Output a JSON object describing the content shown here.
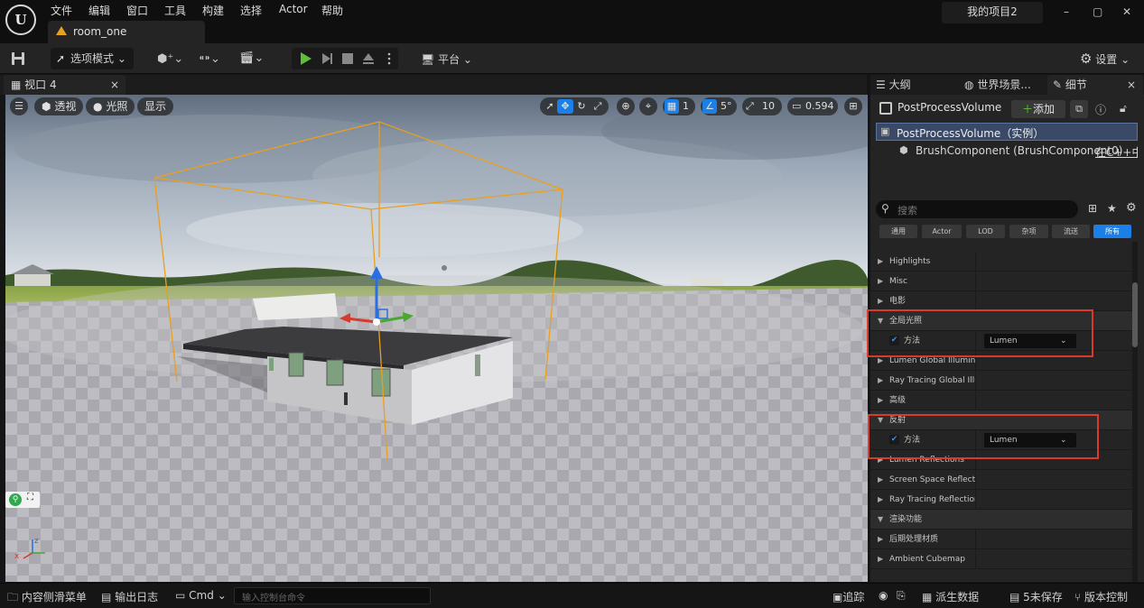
{
  "menubar": {
    "logo_text": "U",
    "items": [
      "文件",
      "编辑",
      "窗口",
      "工具",
      "构建",
      "选择",
      "Actor",
      "帮助"
    ],
    "project_name": "我的项目2",
    "window_controls": [
      "–",
      "▢",
      "✕"
    ]
  },
  "level_tab": {
    "label": "room_one"
  },
  "toolbar": {
    "mode_label": "选项模式",
    "platform_label": "平台",
    "settings_label": "设置"
  },
  "viewport_tab": {
    "label": "视口 4"
  },
  "viewport": {
    "perspective_label": "透视",
    "lit_label": "光照",
    "show_label": "显示",
    "grid_snap_value": "1",
    "angle_snap_value": "5°",
    "scale_snap_value": "10",
    "camera_speed_value": "0.594",
    "axis_x": "x",
    "axis_z": "z"
  },
  "right_panel": {
    "tabs": [
      "大纲",
      "世界场景...",
      "细节"
    ],
    "actor_name": "PostProcessVolume",
    "add_label": "添加",
    "tree": {
      "root": "PostProcessVolume（实例）",
      "child": "BrushComponent (BrushComponent0)",
      "child_link": "在C++中"
    },
    "search_placeholder": "搜索",
    "filters": [
      "通用",
      "Actor",
      "LOD",
      "杂项",
      "流送",
      "所有"
    ],
    "active_filter": "所有",
    "properties": {
      "highlights": "Highlights",
      "misc": "Misc",
      "film": "电影",
      "gi_header": "全局光照",
      "gi_method_label": "方法",
      "gi_method_value": "Lumen",
      "lumen_gi": "Lumen Global Illumination",
      "rt_gi": "Ray Tracing Global Illumination",
      "advanced": "高级",
      "refl_header": "反射",
      "refl_method_label": "方法",
      "refl_method_value": "Lumen",
      "lumen_refl": "Lumen Reflections",
      "ssr": "Screen Space Reflections",
      "rt_refl": "Ray Tracing Reflections",
      "render_features": "渲染功能",
      "pp_materials": "后期处理材质",
      "ambient_cubemap": "Ambient Cubemap"
    }
  },
  "statusbar": {
    "content_drawer": "内容侧滑菜单",
    "output_log": "输出日志",
    "cmd_label": "Cmd",
    "console_placeholder": "输入控制台命令",
    "trace_label": "追踪",
    "derived_data": "派生数据",
    "unsaved": "5未保存",
    "source_control": "版本控制"
  },
  "colors": {
    "accent_blue": "#1a7fe6",
    "highlight_red": "#d93a2a",
    "play_green": "#5fbf3b"
  }
}
